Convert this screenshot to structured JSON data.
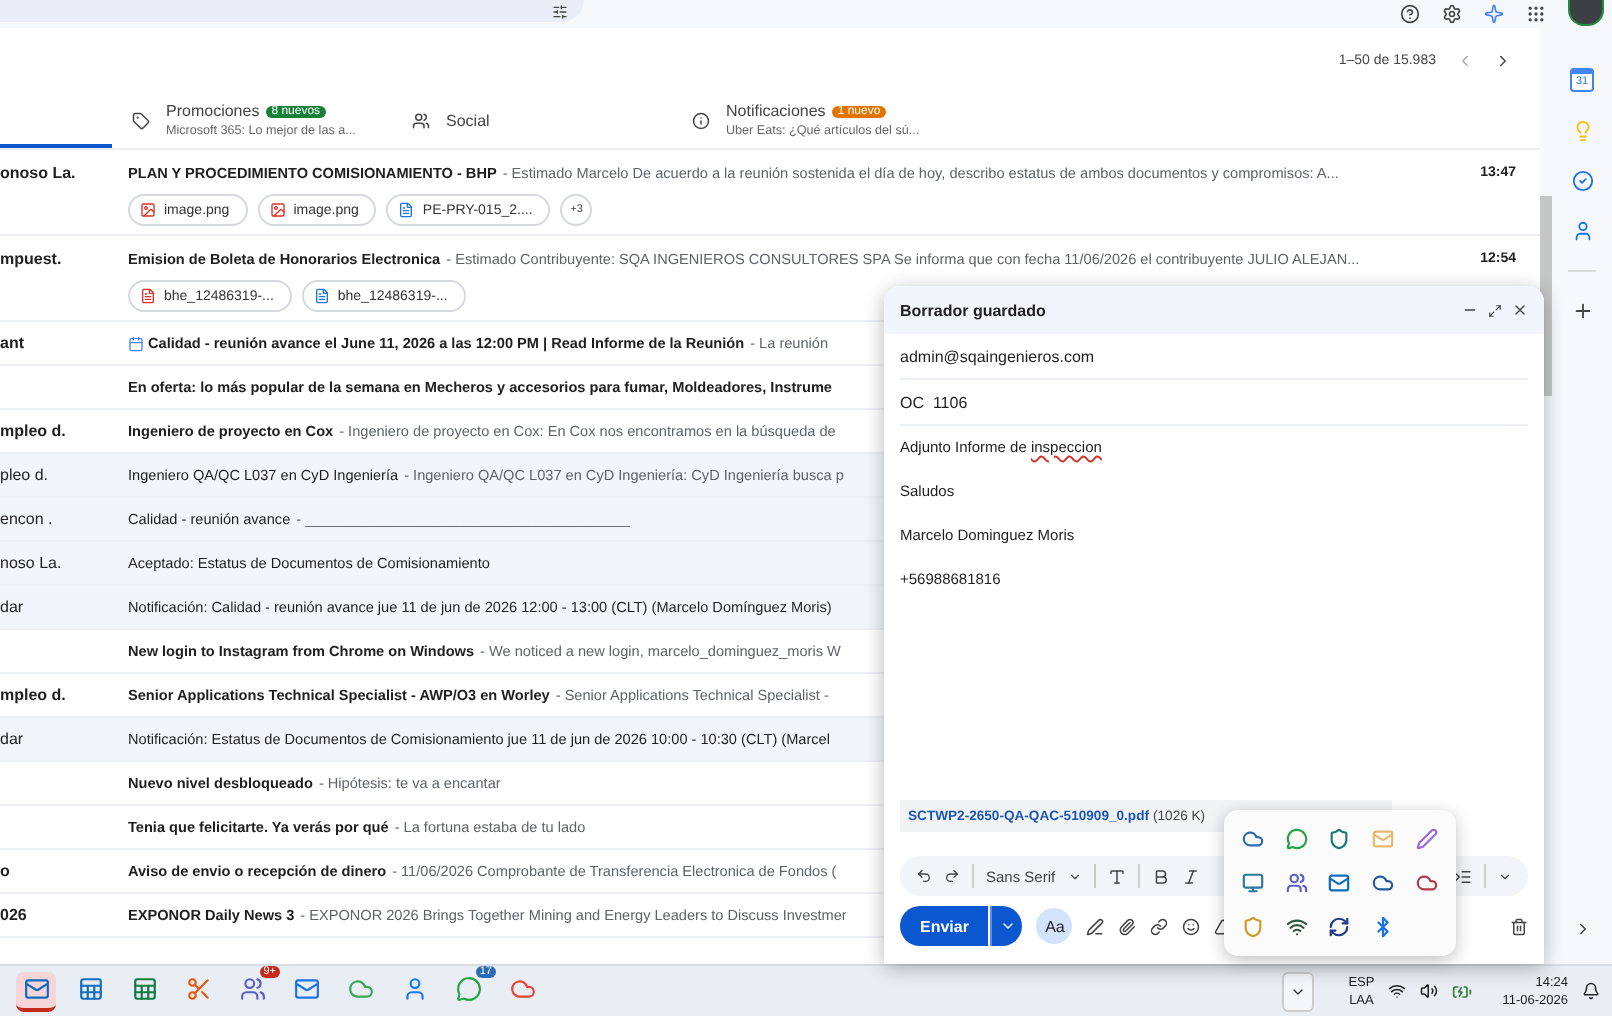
{
  "pagination": {
    "range": "1–50 de 15.983"
  },
  "tabs": [
    {
      "kind": "cut",
      "selected": true
    },
    {
      "kind": "tab",
      "label": "Promociones",
      "badge": "8 nuevos",
      "color": "#188038",
      "preview": "Microsoft 365: Lo mejor de las a...",
      "selected": false
    },
    {
      "kind": "tab",
      "label": "Social",
      "selected": false
    },
    {
      "kind": "tab",
      "label": "Notificaciones",
      "badge": "1 nuevo",
      "color": "#e37400",
      "preview": "Uber Eats: ¿Qué artículos del sú...",
      "selected": false
    }
  ],
  "emails": [
    {
      "sender": "onoso La.",
      "subject": "PLAN Y PROCEDIMIENTO COMISIONAMIENTO - BHP",
      "snippet": "- Estimado Marcelo De acuerdo a la reunión sostenida el día de hoy, describo estatus de ambos documentos y compromisos: A...",
      "time": "13:47",
      "unread": true,
      "attachments": [
        {
          "kind": "image",
          "name": "image.png"
        },
        {
          "kind": "image",
          "name": "image.png"
        },
        {
          "kind": "doc",
          "name": "PE-PRY-015_2...."
        },
        {
          "kind": "more",
          "name": "+3"
        }
      ]
    },
    {
      "sender": "mpuest.",
      "subject": "Emision de Boleta de Honorarios Electronica",
      "snippet": "- Estimado Contribuyente: SQA INGENIEROS CONSULTORES SPA Se informa que con fecha 11/06/2026 el contribuyente JULIO ALEJAN...",
      "time": "12:54",
      "unread": true,
      "attachments": [
        {
          "kind": "pdf",
          "name": "bhe_12486319-..."
        },
        {
          "kind": "doc",
          "name": "bhe_12486319-..."
        }
      ]
    },
    {
      "sender": "ant",
      "kind": "event",
      "subject": "Calidad - reunión avance el June 11, 2026 a las 12:00 PM | Read Informe de la Reunión",
      "snippet": "- La reunión",
      "unread": true
    },
    {
      "subject": "En oferta: lo más popular de la semana en Mecheros y accesorios para fumar, Moldeadores, Instrume",
      "unread": true
    },
    {
      "sender": "mpleo d.",
      "subject": "Ingeniero de proyecto en Cox",
      "snippet": "- Ingeniero de proyecto en Cox: En Cox nos encontramos en la búsqueda de",
      "unread": true
    },
    {
      "sender": "pleo d.",
      "subject": "Ingeniero QA/QC L037 en CyD Ingeniería",
      "snippet": "- Ingeniero QA/QC L037 en CyD Ingeniería: CyD Ingeniería busca p",
      "unread": false
    },
    {
      "sender": "encon .",
      "subject": "Calidad - reunión avance",
      "snippet": "- ________________________________________",
      "unread": false
    },
    {
      "sender": "noso La.",
      "subject": "Aceptado: Estatus de Documentos de Comisionamiento",
      "unread": false
    },
    {
      "sender": "dar",
      "subject": "Notificación: Calidad - reunión avance jue 11 de jun de 2026 12:00 - 13:00 (CLT) (Marcelo Domínguez Moris)",
      "unread": false
    },
    {
      "subject": "New login to Instagram from Chrome on Windows",
      "snippet": "- We noticed a new login, marcelo_dominguez_moris W",
      "unread": true
    },
    {
      "sender": "mpleo d.",
      "subject": "Senior Applications Technical Specialist - AWP/O3 en Worley",
      "snippet": "- Senior Applications Technical Specialist -",
      "unread": true
    },
    {
      "sender": "dar",
      "subject": "Notificación: Estatus de Documentos de Comisionamiento jue 11 de jun de 2026 10:00 - 10:30 (CLT) (Marcel",
      "unread": false
    },
    {
      "subject": "Nuevo nivel desbloqueado",
      "snippet": "- Hipótesis: te va a encantar",
      "unread": true
    },
    {
      "subject": "Tenia que felicitarte. Ya verás por qué",
      "snippet": "- La fortuna estaba de tu lado",
      "unread": true
    },
    {
      "sender": "o",
      "subject": "Aviso de envio o recepción de dinero",
      "snippet": "- 11/06/2026 Comprobante de Transferencia Electronica de Fondos (",
      "unread": true
    },
    {
      "sender": "026",
      "subject": "EXPONOR Daily News 3",
      "snippet": "- EXPONOR 2026 Brings Together Mining and Energy Leaders to Discuss Investmer",
      "unread": true
    }
  ],
  "side_panel": {
    "calendar_day": "31"
  },
  "compose": {
    "title": "Borrador guardado",
    "to": "admin@sqaingenieros.com",
    "subject": "OC  1106",
    "body": [
      {
        "text": "Adjunto Informe de ",
        "flagged": "inspeccion"
      },
      {
        "text": "Saludos"
      },
      {
        "text": "Marcelo Dominguez Moris"
      },
      {
        "text": "+56988681816"
      }
    ],
    "attachment": {
      "name": "SCTWP2-2650-QA-QAC-510909_0.pdf",
      "size": "(1026 K)"
    },
    "font": "Sans Serif",
    "send": "Enviar",
    "format": "Aa"
  },
  "taskbar": {
    "apps": [
      {
        "selected": true
      },
      {
        "selected": false
      },
      {
        "selected": false
      },
      {
        "selected": false
      },
      {
        "selected": false,
        "badge": "9+"
      },
      {
        "selected": false
      },
      {
        "selected": false
      },
      {
        "selected": false
      },
      {
        "selected": false,
        "badge": "17"
      },
      {
        "selected": false
      }
    ],
    "language": [
      "ESP",
      "LAA"
    ],
    "time": "14:24",
    "date": "11-06-2026"
  }
}
